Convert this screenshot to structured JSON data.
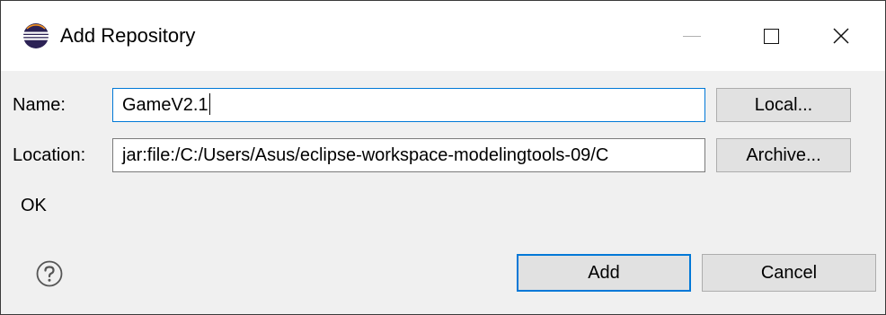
{
  "window": {
    "title": "Add Repository",
    "app_icon": "eclipse-logo-icon",
    "controls": {
      "minimize_icon": "minimize-icon",
      "maximize_icon": "maximize-icon",
      "close_icon": "close-icon",
      "close_glyph": "✕"
    }
  },
  "form": {
    "name": {
      "label": "Name:",
      "value": "GameV2.1"
    },
    "location": {
      "label": "Location:",
      "value": "jar:file:/C:/Users/Asus/eclipse-workspace-modelingtools-09/C"
    },
    "local_button": "Local...",
    "archive_button": "Archive..."
  },
  "status": {
    "message": "OK"
  },
  "footer": {
    "help_icon": "help-icon",
    "add_button": "Add",
    "cancel_button": "Cancel"
  },
  "colors": {
    "focus_accent": "#0078d7",
    "dialog_background": "#f0f0f0",
    "button_face": "#e1e1e1",
    "eclipse_purple": "#2c2255",
    "eclipse_orange": "#f7941e"
  }
}
